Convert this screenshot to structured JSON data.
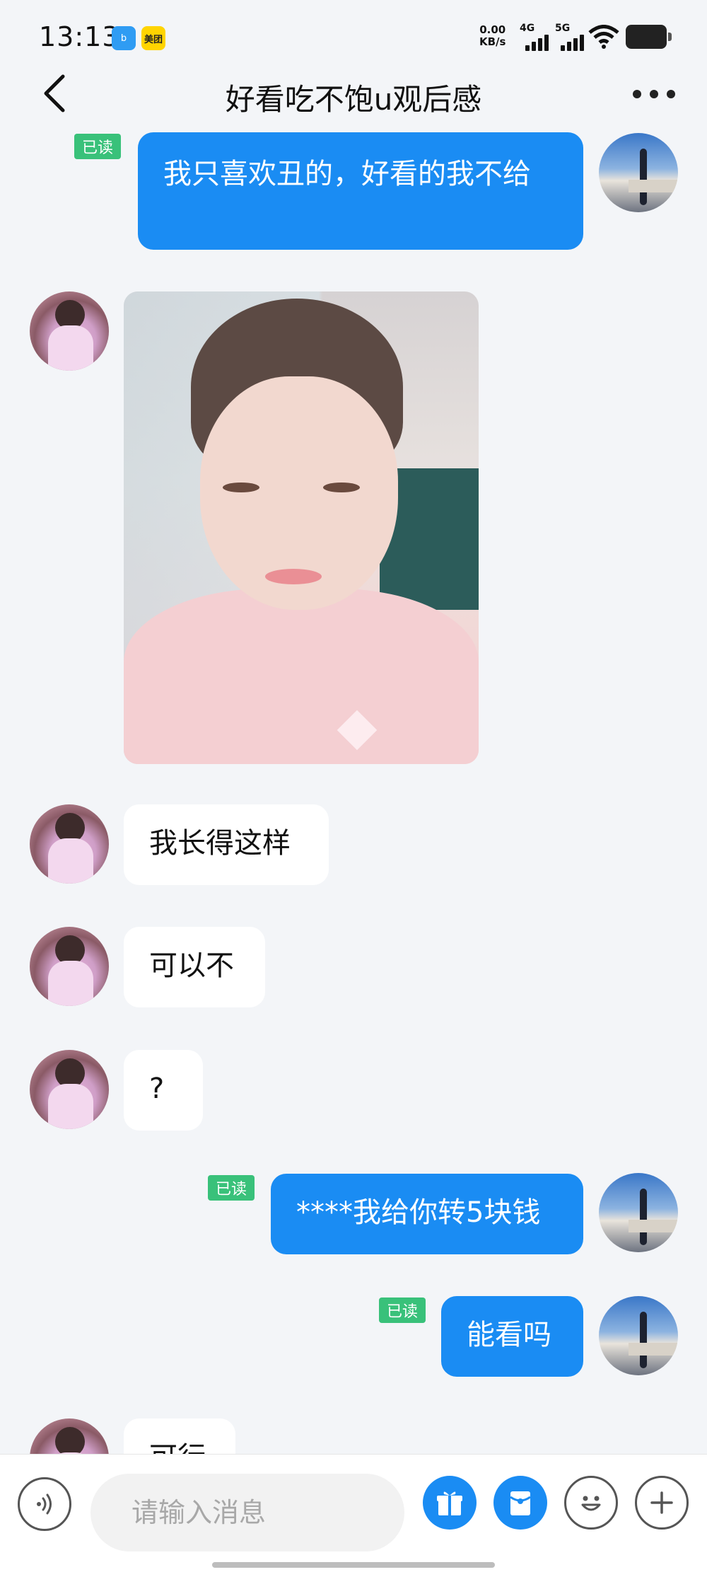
{
  "status_bar": {
    "time": "13:13",
    "badge_1": "b",
    "badge_2": "美团",
    "net_speed_value": "0.00",
    "net_speed_unit": "KB/s",
    "signal_1": "4G",
    "signal_2": "5G"
  },
  "header": {
    "title": "好看吃不饱u观后感"
  },
  "messages": [
    {
      "side": "self",
      "text": "我只喜欢丑的，好看的我不给",
      "read": "已读"
    },
    {
      "side": "other",
      "type": "image"
    },
    {
      "side": "other",
      "text": "我长得这样"
    },
    {
      "side": "other",
      "text": "可以不"
    },
    {
      "side": "other",
      "text": "?"
    },
    {
      "side": "self",
      "text": "****我给你转5块钱",
      "read": "已读"
    },
    {
      "side": "self",
      "text": "能看吗",
      "read": "已读"
    },
    {
      "side": "other",
      "text": "可行"
    }
  ],
  "input_bar": {
    "placeholder": "请输入消息"
  },
  "colors": {
    "self_bubble": "#1a8cf3",
    "read_badge": "#39c17a",
    "background": "#f3f5f8"
  }
}
